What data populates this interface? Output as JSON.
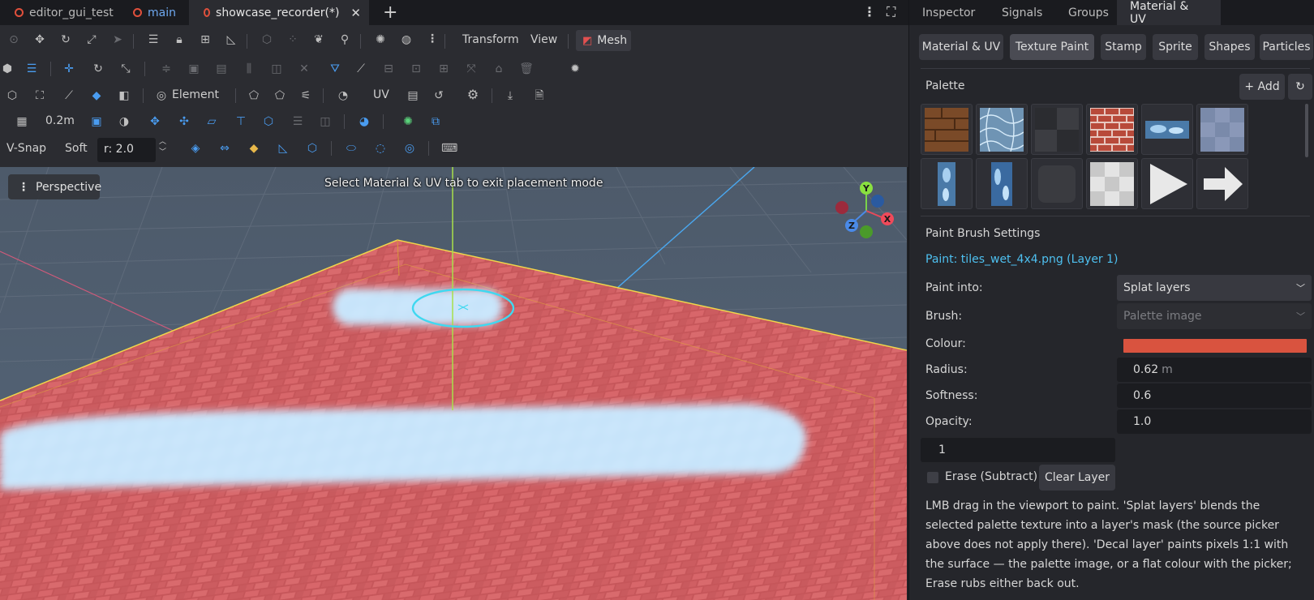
{
  "editor_tabs": [
    {
      "label": "editor_gui_test"
    },
    {
      "label": "main"
    },
    {
      "label": "showcase_recorder(*)"
    }
  ],
  "toolbar": {
    "transform_label": "Transform",
    "view_label": "View",
    "mesh_label": "Mesh",
    "element_label": "Element",
    "uv_label": "UV",
    "grid_size": "0.2m",
    "vsnap_label": "V-Snap",
    "soft_label": "Soft",
    "radius_value": "r: 2.0"
  },
  "viewport": {
    "perspective_label": "Perspective",
    "hint": "Select Material & UV tab to exit placement mode",
    "gizmo": {
      "x": "X",
      "y": "Y",
      "z": "Z"
    }
  },
  "right_tabs": [
    {
      "label": "Inspector"
    },
    {
      "label": "Signals"
    },
    {
      "label": "Groups"
    },
    {
      "label": "Material & UV"
    }
  ],
  "sub_tabs": [
    {
      "label": "Material & UV"
    },
    {
      "label": "Texture Paint"
    },
    {
      "label": "Stamp"
    },
    {
      "label": "Sprite"
    },
    {
      "label": "Shapes"
    },
    {
      "label": "Particles"
    }
  ],
  "palette": {
    "title": "Palette",
    "add_label": "+ Add",
    "refresh_icon": "refresh-icon"
  },
  "brush": {
    "title": "Paint Brush Settings",
    "paint_target": "Paint: tiles_wet_4x4.png (Layer 1)",
    "paint_into_label": "Paint into:",
    "paint_into_value": "Splat layers",
    "brush_label": "Brush:",
    "brush_value": "Palette image",
    "colour_label": "Colour:",
    "colour_value": "#d9533f",
    "radius_label": "Radius:",
    "radius_value": "0.62",
    "radius_unit": "m",
    "softness_label": "Softness:",
    "softness_value": "0.6",
    "opacity_label": "Opacity:",
    "opacity_value": "1.0",
    "layer_value": "1",
    "erase_label": "Erase (Subtract)",
    "clear_label": "Clear Layer",
    "help_text": "LMB drag in the viewport to paint. 'Splat layers' blends the selected palette texture into a layer's mask (the source picker above does not apply there). 'Decal layer' paints pixels 1:1 with the surface — the palette image, or a flat colour with the picker; Erase rubs either back out."
  },
  "colors": {
    "accent_blue": "#4a9cf0",
    "link_cyan": "#4ec0f0",
    "close_red": "#e0503c"
  }
}
